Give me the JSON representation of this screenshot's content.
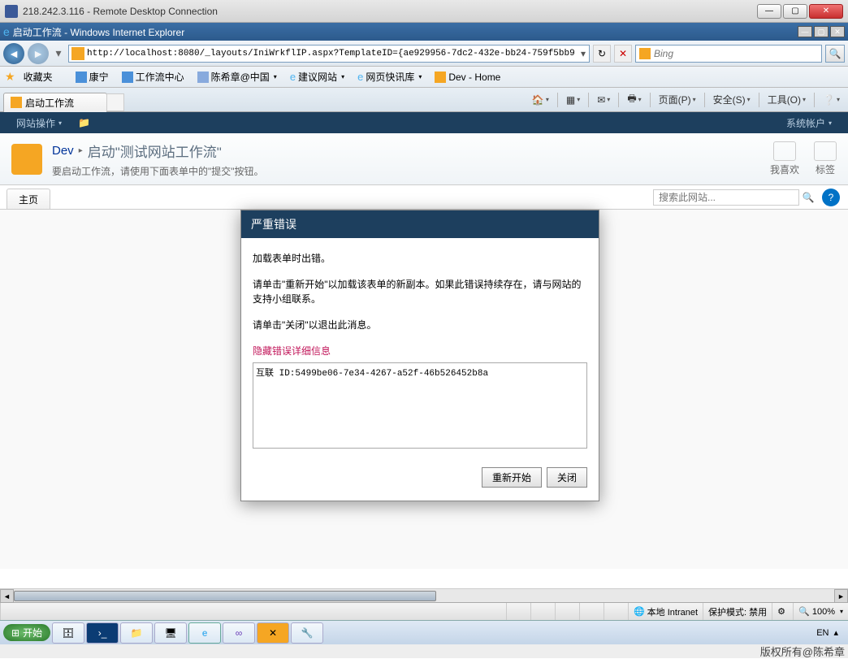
{
  "rdc": {
    "title": "218.242.3.116 - Remote Desktop Connection",
    "min": "—",
    "max": "▢",
    "close": "✕"
  },
  "ie": {
    "title": "启动工作流 - Windows Internet Explorer",
    "url": "http://localhost:8080/_layouts/IniWrkflIP.aspx?TemplateID={ae929956-7dc2-432e-bb24-759f5bb9",
    "search_placeholder": "Bing"
  },
  "favbar": {
    "label": "收藏夹",
    "items": [
      "康宁",
      "工作流中心",
      "陈希章@中国",
      "建议网站",
      "网页快讯库",
      "Dev - Home"
    ]
  },
  "tab": {
    "title": "启动工作流"
  },
  "cmdbar": {
    "page": "页面(P)",
    "safety": "安全(S)",
    "tools": "工具(O)"
  },
  "sp": {
    "ribbon": {
      "siteactions": "网站操作",
      "account": "系统帐户"
    },
    "breadcrumb": {
      "dev": "Dev",
      "page": "启动\"测试网站工作流\""
    },
    "subtitle": "要启动工作流，请使用下面表单中的\"提交\"按钮。",
    "actions": {
      "like": "我喜欢",
      "tag": "标签"
    },
    "hometab": "主页",
    "search_placeholder": "搜索此网站..."
  },
  "dialog": {
    "title": "严重错误",
    "p1": "加载表单时出错。",
    "p2": "请单击\"重新开始\"以加载该表单的新副本。如果此错误持续存在，请与网站的支持小组联系。",
    "p3": "请单击\"关闭\"以退出此消息。",
    "link": "隐藏错误详细信息",
    "detail": "互联 ID:5499be06-7e34-4267-a52f-46b526452b8a",
    "restart": "重新开始",
    "close": "关闭"
  },
  "status": {
    "zone": "本地 Intranet",
    "protect": "保护模式: 禁用",
    "zoom": "100%"
  },
  "taskbar": {
    "start": "开始",
    "lang": "EN"
  },
  "watermark": "版权所有@陈希章"
}
